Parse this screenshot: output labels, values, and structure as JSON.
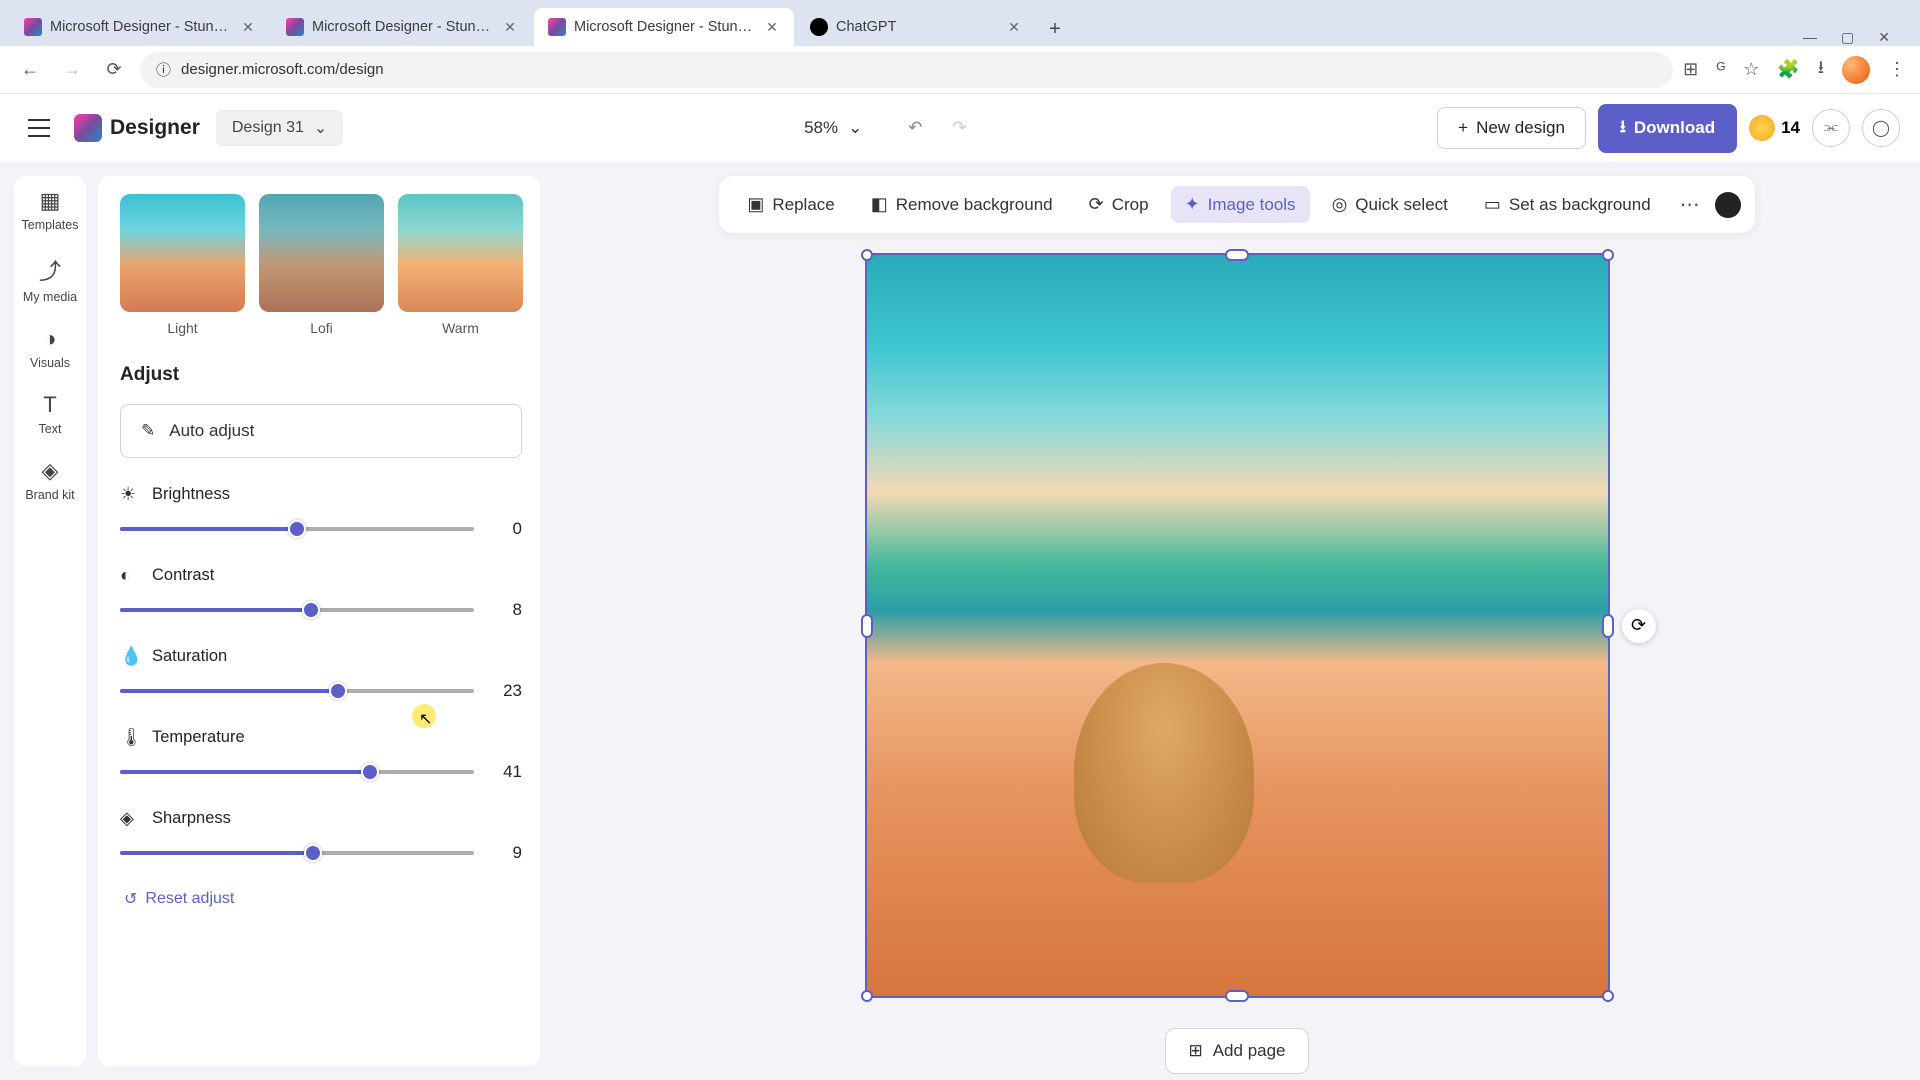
{
  "browser": {
    "tabs": [
      {
        "title": "Microsoft Designer - Stunning ...",
        "active": false
      },
      {
        "title": "Microsoft Designer - Stunning ...",
        "active": false
      },
      {
        "title": "Microsoft Designer - Stunning ...",
        "active": true
      },
      {
        "title": "ChatGPT",
        "active": false
      }
    ],
    "url": "designer.microsoft.com/design"
  },
  "app": {
    "logo_text": "Designer",
    "design_name": "Design 31",
    "zoom": "58%",
    "coins": "14",
    "new_design": "New design",
    "download": "Download"
  },
  "rail": [
    {
      "label": "Templates"
    },
    {
      "label": "My media"
    },
    {
      "label": "Visuals"
    },
    {
      "label": "Text"
    },
    {
      "label": "Brand kit"
    }
  ],
  "panel": {
    "filters": [
      {
        "label": "Light"
      },
      {
        "label": "Lofi"
      },
      {
        "label": "Warm"
      }
    ],
    "adjust_heading": "Adjust",
    "auto_adjust": "Auto adjust",
    "sliders": [
      {
        "label": "Brightness",
        "value": "0",
        "pct": 50
      },
      {
        "label": "Contrast",
        "value": "8",
        "pct": 54
      },
      {
        "label": "Saturation",
        "value": "23",
        "pct": 61.5
      },
      {
        "label": "Temperature",
        "value": "41",
        "pct": 70.5
      },
      {
        "label": "Sharpness",
        "value": "9",
        "pct": 54.5
      }
    ],
    "reset": "Reset adjust"
  },
  "toolbar": {
    "replace": "Replace",
    "remove_bg": "Remove background",
    "crop": "Crop",
    "image_tools": "Image tools",
    "quick_select": "Quick select",
    "set_bg": "Set as background"
  },
  "add_page": "Add page"
}
